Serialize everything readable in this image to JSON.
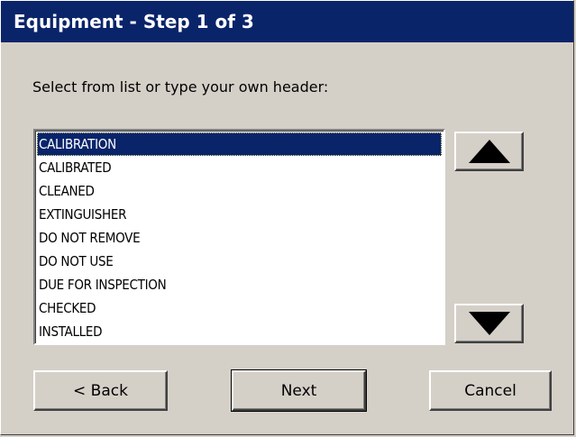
{
  "window": {
    "title": "Equipment - Step 1 of 3"
  },
  "prompt": "Select from list or type your own header:",
  "list": {
    "items": [
      "CALIBRATION",
      "CALIBRATED",
      "CLEANED",
      "EXTINGUISHER",
      "DO NOT REMOVE",
      "DO NOT USE",
      "DUE FOR INSPECTION",
      "CHECKED",
      "INSTALLED"
    ],
    "selected": "CALIBRATION"
  },
  "scroll": {
    "up_icon": "triangle-up-icon",
    "down_icon": "triangle-down-icon"
  },
  "buttons": {
    "back": "< Back",
    "next": "Next",
    "cancel": "Cancel"
  },
  "colors": {
    "titlebar": "#0a246a",
    "selection": "#0a246a",
    "face": "#d4d0c8"
  }
}
